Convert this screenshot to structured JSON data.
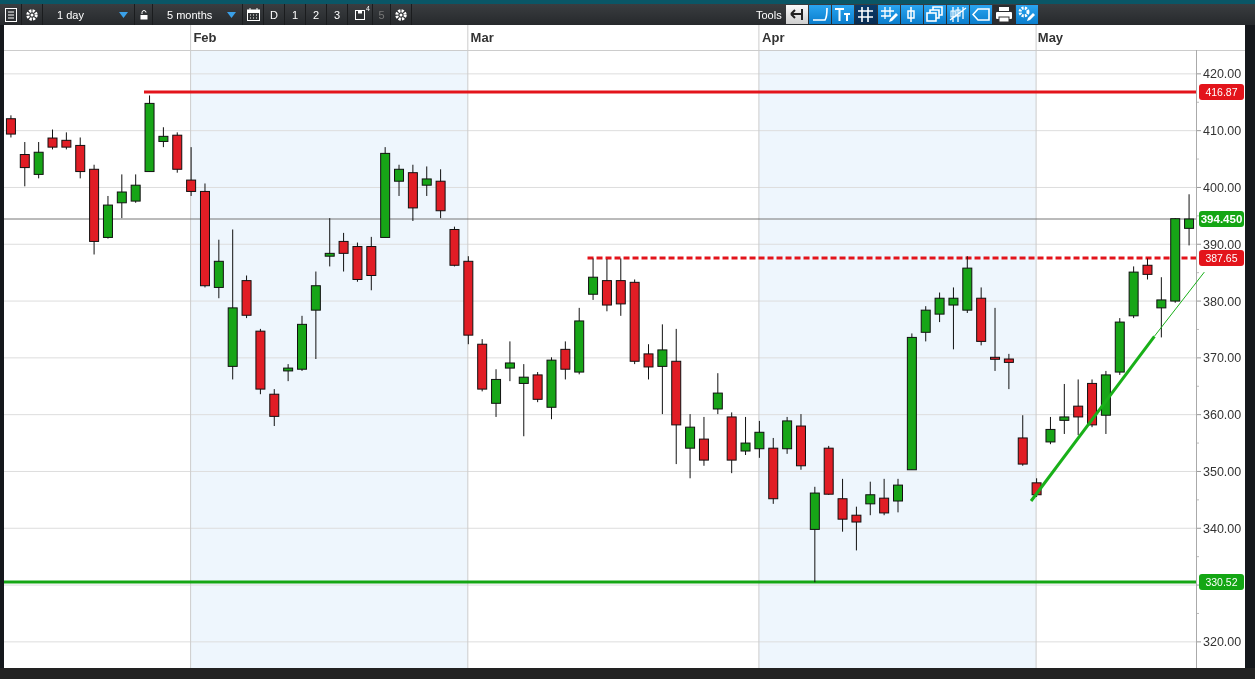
{
  "toolbar": {
    "interval": {
      "value": "1 day"
    },
    "range": {
      "value": "5 months"
    },
    "periods": [
      {
        "label": "D",
        "disabled": false
      },
      {
        "label": "1",
        "disabled": false
      },
      {
        "label": "2",
        "disabled": false
      },
      {
        "label": "3",
        "disabled": false
      }
    ],
    "save_count": "4",
    "period_5": {
      "label": "5",
      "disabled": true
    },
    "tools_label": "Tools",
    "tools": [
      {
        "kind": "back",
        "selected": false
      },
      {
        "kind": "curve",
        "selected": false
      },
      {
        "kind": "text",
        "selected": false
      },
      {
        "kind": "grid",
        "selected": true
      },
      {
        "kind": "draw",
        "selected": false
      },
      {
        "kind": "candle",
        "selected": false
      },
      {
        "kind": "layers",
        "selected": false
      },
      {
        "kind": "candles",
        "selected": false
      },
      {
        "kind": "tag",
        "selected": false
      },
      {
        "kind": "print",
        "selected": false
      },
      {
        "kind": "config",
        "selected": false
      }
    ]
  },
  "chart": {
    "chart_data": {
      "type": "candlestick",
      "categories": [
        null,
        null,
        null,
        null,
        null,
        null,
        null,
        null,
        null,
        null,
        null,
        null,
        null,
        null,
        "Feb",
        null,
        null,
        null,
        null,
        null,
        null,
        null,
        null,
        null,
        null,
        null,
        null,
        null,
        null,
        null,
        null,
        null,
        null,
        null,
        "Mar",
        null,
        null,
        null,
        null,
        null,
        null,
        null,
        null,
        null,
        null,
        null,
        null,
        null,
        null,
        null,
        null,
        null,
        null,
        null,
        null,
        "Apr",
        null,
        null,
        null,
        null,
        null,
        null,
        null,
        null,
        null,
        null,
        null,
        null,
        null,
        null,
        null,
        null,
        null,
        null,
        null,
        "May",
        null,
        null,
        null,
        null,
        null,
        null,
        null,
        null,
        null,
        null
      ],
      "ohlc": [
        [
          412.1,
          412.7,
          408.8,
          409.4
        ],
        [
          405.8,
          408.0,
          400.2,
          403.5
        ],
        [
          402.3,
          408.0,
          401.6,
          406.2
        ],
        [
          408.7,
          410.2,
          406.7,
          407.1
        ],
        [
          408.3,
          409.7,
          406.7,
          407.1
        ],
        [
          407.4,
          408.8,
          401.6,
          402.8
        ],
        [
          403.2,
          404.0,
          388.2,
          390.5
        ],
        [
          391.2,
          398.5,
          391.0,
          396.9
        ],
        [
          397.3,
          402.3,
          394.6,
          399.2
        ],
        [
          397.6,
          402.3,
          397.3,
          400.4
        ],
        [
          402.8,
          416.2,
          402.8,
          414.8
        ],
        [
          408.1,
          410.6,
          407.1,
          409.0
        ],
        [
          409.2,
          409.7,
          402.6,
          403.2
        ],
        [
          401.3,
          407.1,
          398.5,
          399.3
        ],
        [
          399.3,
          400.7,
          382.4,
          382.7
        ],
        [
          382.4,
          390.8,
          380.5,
          387.0
        ],
        [
          368.5,
          392.6,
          366.2,
          378.8
        ],
        [
          383.6,
          384.5,
          377.0,
          377.5
        ],
        [
          374.7,
          375.1,
          363.6,
          364.5
        ],
        [
          363.6,
          364.5,
          358.0,
          359.7
        ],
        [
          367.7,
          368.9,
          365.9,
          368.2
        ],
        [
          368.0,
          377.4,
          367.7,
          375.9
        ],
        [
          378.4,
          385.2,
          369.8,
          382.7
        ],
        [
          387.9,
          394.6,
          386.1,
          388.4
        ],
        [
          390.5,
          392.0,
          385.2,
          388.4
        ],
        [
          389.6,
          390.3,
          383.4,
          383.8
        ],
        [
          389.6,
          391.3,
          381.9,
          384.5
        ],
        [
          391.2,
          407.1,
          391.2,
          406.0
        ],
        [
          401.1,
          404.0,
          398.5,
          403.2
        ],
        [
          402.6,
          404.0,
          394.1,
          396.4
        ],
        [
          400.4,
          403.7,
          398.5,
          401.5
        ],
        [
          401.1,
          403.2,
          394.6,
          395.9
        ],
        [
          392.6,
          393.1,
          386.1,
          386.3
        ],
        [
          387.0,
          387.9,
          372.4,
          374.0
        ],
        [
          372.4,
          373.3,
          364.1,
          364.5
        ],
        [
          362.0,
          368.0,
          359.6,
          366.2
        ],
        [
          368.2,
          372.9,
          365.9,
          369.1
        ],
        [
          365.5,
          368.9,
          356.2,
          366.6
        ],
        [
          367.0,
          367.5,
          362.2,
          362.7
        ],
        [
          361.3,
          370.1,
          359.2,
          369.6
        ],
        [
          371.5,
          372.9,
          366.2,
          368.0
        ],
        [
          367.5,
          378.8,
          367.1,
          376.5
        ],
        [
          381.2,
          387.5,
          380.2,
          384.2
        ],
        [
          383.6,
          387.4,
          378.2,
          379.3
        ],
        [
          383.6,
          387.5,
          377.4,
          379.5
        ],
        [
          383.3,
          383.8,
          368.9,
          369.4
        ],
        [
          370.7,
          372.4,
          366.2,
          368.4
        ],
        [
          368.5,
          375.9,
          360.1,
          371.4
        ],
        [
          369.4,
          375.1,
          351.3,
          358.2
        ],
        [
          354.1,
          360.1,
          348.8,
          357.8
        ],
        [
          355.7,
          359.6,
          351.0,
          352.0
        ],
        [
          361.0,
          367.3,
          360.1,
          363.8
        ],
        [
          359.6,
          360.4,
          349.7,
          352.0
        ],
        [
          353.6,
          359.6,
          352.9,
          355.0
        ],
        [
          354.0,
          358.9,
          352.4,
          356.9
        ],
        [
          354.1,
          355.9,
          344.3,
          345.2
        ],
        [
          354.0,
          359.6,
          353.1,
          358.9
        ],
        [
          358.0,
          360.1,
          350.3,
          351.0
        ],
        [
          339.8,
          347.3,
          330.5,
          346.2
        ],
        [
          354.1,
          354.5,
          345.9,
          346.0
        ],
        [
          345.2,
          348.7,
          339.4,
          341.6
        ],
        [
          342.3,
          343.8,
          336.1,
          341.1
        ],
        [
          344.3,
          348.2,
          342.3,
          345.9
        ],
        [
          345.3,
          348.7,
          342.3,
          342.7
        ],
        [
          344.8,
          348.7,
          342.8,
          347.6
        ],
        [
          350.3,
          374.3,
          350.3,
          373.6
        ],
        [
          374.5,
          379.1,
          372.9,
          378.4
        ],
        [
          377.7,
          381.5,
          376.3,
          380.5
        ],
        [
          379.3,
          382.4,
          371.5,
          380.5
        ],
        [
          378.4,
          387.9,
          377.9,
          385.8
        ],
        [
          380.5,
          382.4,
          372.2,
          372.9
        ],
        [
          370.1,
          378.8,
          367.7,
          369.8
        ],
        [
          369.8,
          370.7,
          364.5,
          369.2
        ],
        [
          355.9,
          359.9,
          351.0,
          351.3
        ],
        [
          348.0,
          348.8,
          345.5,
          345.9
        ],
        [
          355.2,
          359.6,
          354.8,
          357.4
        ],
        [
          359.0,
          365.4,
          356.6,
          359.6
        ],
        [
          361.5,
          366.2,
          356.4,
          359.6
        ],
        [
          365.5,
          366.2,
          357.8,
          358.2
        ],
        [
          359.9,
          367.7,
          356.6,
          367.0
        ],
        [
          367.5,
          377.0,
          367.0,
          376.3
        ],
        [
          377.4,
          386.1,
          377.0,
          385.1
        ],
        [
          386.3,
          387.5,
          383.8,
          384.7
        ],
        [
          378.8,
          384.2,
          373.6,
          380.2
        ],
        [
          380.0,
          394.6,
          379.7,
          394.5
        ],
        [
          392.8,
          398.8,
          389.8,
          394.45
        ]
      ],
      "ylim": [
        315.4,
        424.2
      ],
      "grid": true,
      "yticks": [
        {
          "value": 420,
          "label": "420.00"
        },
        {
          "value": 410,
          "label": "410.00"
        },
        {
          "value": 400,
          "label": "400.00"
        },
        {
          "value": 390,
          "label": "390.00"
        },
        {
          "value": 380,
          "label": "380.00"
        },
        {
          "value": 370,
          "label": "370.00"
        },
        {
          "value": 360,
          "label": "360.00"
        },
        {
          "value": 350,
          "label": "350.00"
        },
        {
          "value": 340,
          "label": "340.00"
        },
        {
          "value": 320,
          "label": "320.00"
        }
      ],
      "ref_lines": [
        {
          "axis": "y",
          "value": 416.87,
          "label": "416.87",
          "color": "#e3141b"
        },
        {
          "axis": "y",
          "value": 394.45,
          "label": "394.450",
          "color": "#777777"
        },
        {
          "axis": "y",
          "value": 387.65,
          "label": "387.65",
          "color": "#e3141b"
        },
        {
          "axis": "y",
          "value": 330.52,
          "label": "330.52",
          "color": "#14a614"
        }
      ]
    }
  }
}
